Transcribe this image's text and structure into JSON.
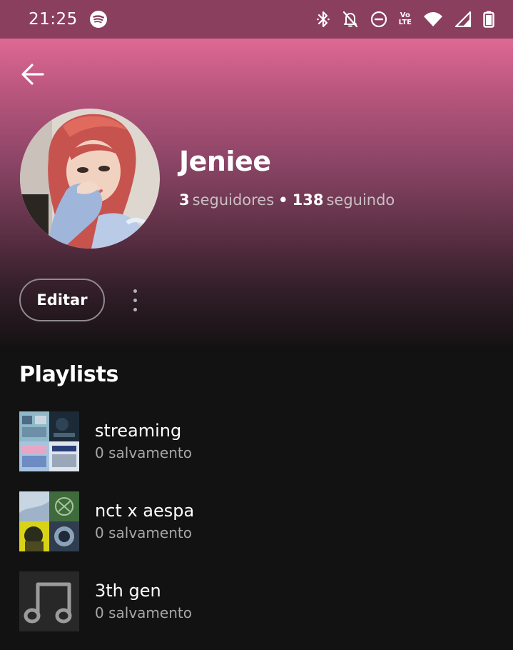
{
  "status_bar": {
    "time": "21:25",
    "icons": [
      "spotify-icon",
      "bluetooth-icon",
      "muted-bell-icon",
      "do-not-disturb-icon",
      "volte-icon",
      "wifi-icon",
      "signal-icon",
      "battery-icon"
    ],
    "volte_top": "Vo",
    "volte_bottom": "LTE"
  },
  "header": {
    "back_icon": "arrow-left-icon"
  },
  "profile": {
    "name": "Jeniee",
    "followers_count": "3",
    "followers_label": "seguidores",
    "following_count": "138",
    "following_label": "seguindo",
    "separator": "•"
  },
  "actions": {
    "edit_label": "Editar",
    "more_icon": "more-vertical-icon"
  },
  "playlists": {
    "title": "Playlists",
    "items": [
      {
        "name": "streaming",
        "saves": "0 salvamento"
      },
      {
        "name": "nct x aespa",
        "saves": "0 salvamento"
      },
      {
        "name": "3th gen",
        "saves": "0 salvamento"
      }
    ]
  },
  "colors": {
    "status_bar": "#8a3f5f",
    "gradient_top": "#dd6994",
    "background": "#121212",
    "secondary_text": "#a7a7a7"
  }
}
